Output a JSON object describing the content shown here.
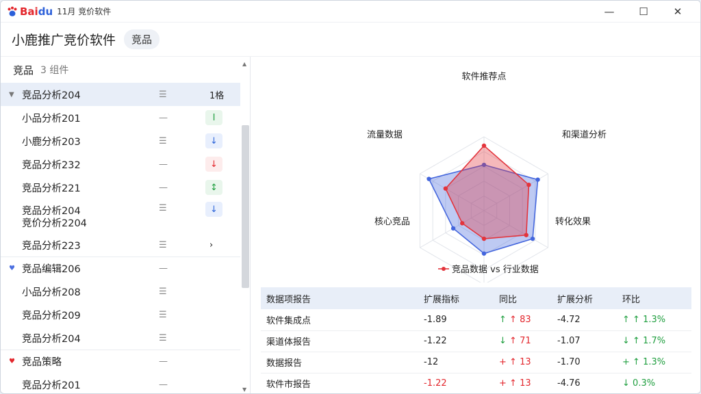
{
  "window": {
    "app_name": "11月 竞价软件",
    "logo_text_red": "Bai",
    "logo_text_blue": "du"
  },
  "header": {
    "title": "小鹿推广竞价软件",
    "pill": "竞品"
  },
  "list": {
    "heading": "竞品",
    "count": "3 组件",
    "rows": [
      {
        "name": "竞品分析204",
        "menu": "☰",
        "right": "1格",
        "group": true,
        "selected": true
      },
      {
        "name": "小品分析201",
        "menu": "—",
        "tag": "I",
        "tag_color": "green"
      },
      {
        "name": "小鹿分析203",
        "menu": "☰",
        "tag": "↓",
        "tag_color": "blue"
      },
      {
        "name": "竞品分析232",
        "menu": "—",
        "tag": "↓",
        "tag_color": "red"
      },
      {
        "name": "竞品分析221",
        "menu": "—",
        "tag": "↕",
        "tag_color": "green"
      },
      {
        "name": "竞品分析204",
        "name2": "竞价分析2204",
        "menu": "☰",
        "tag": "↓",
        "tag_color": "blue"
      },
      {
        "name": "竞品分析223",
        "menu": "☰",
        "right": "›"
      },
      {
        "name": "竞品编辑206",
        "menu": "—",
        "group": true
      },
      {
        "name": "小品分析208",
        "menu": "☰"
      },
      {
        "name": "竞品分析209",
        "menu": "☰"
      },
      {
        "name": "竞品分析204",
        "menu": "☰"
      },
      {
        "name": "竞品策略",
        "menu": "—",
        "group": true
      },
      {
        "name": "竞品分析201",
        "menu": "—"
      }
    ]
  },
  "radar": {
    "axes": [
      "软件推荐点",
      "和渠道分析",
      "转化效果",
      "核心竞品",
      "流量数据"
    ],
    "legend": "竞品数据 vs 行业数据"
  },
  "chart_data": {
    "type": "radar",
    "categories": [
      "软件推荐点",
      "和渠道分析",
      "转化效果",
      "核心竞品",
      "流量数据"
    ],
    "series": [
      {
        "color": "#4466dd",
        "values": [
          0.62,
          0.84,
          0.76,
          0.58,
          0.48,
          0.86
        ]
      },
      {
        "color": "#e3343c",
        "values": [
          0.88,
          0.7,
          0.66,
          0.38,
          0.34,
          0.6
        ]
      }
    ]
  },
  "table": {
    "headers": [
      "数据项报告",
      "扩展指标",
      "同比",
      "扩展分析",
      "环比"
    ],
    "rows": [
      {
        "name": "软件集成点",
        "c1": "-1.89",
        "c2": "↑ 83",
        "c2_prefix": "↑",
        "c3": "-4.72",
        "c4": "↑ 1.3%",
        "c4_prefix": "↑"
      },
      {
        "name": "渠道体报告",
        "c1": "-1.22",
        "c2": "↑ 71",
        "c2_prefix": "↓",
        "c3": "-1.07",
        "c4": "↑ 1.7%",
        "c4_prefix": "↓"
      },
      {
        "name": "数据报告",
        "c1": "-12",
        "c2": "↑ 13",
        "c2_prefix": "+",
        "c3": "-1.70",
        "c4": "↑ 1.3%",
        "c4_prefix": "+"
      },
      {
        "name": "软件市报告",
        "c1": "-1.22",
        "c2": "↑ 13",
        "c2_prefix": "+",
        "c3": "-4.76",
        "c4": "0.3%",
        "c4_prefix": "↓"
      }
    ]
  }
}
